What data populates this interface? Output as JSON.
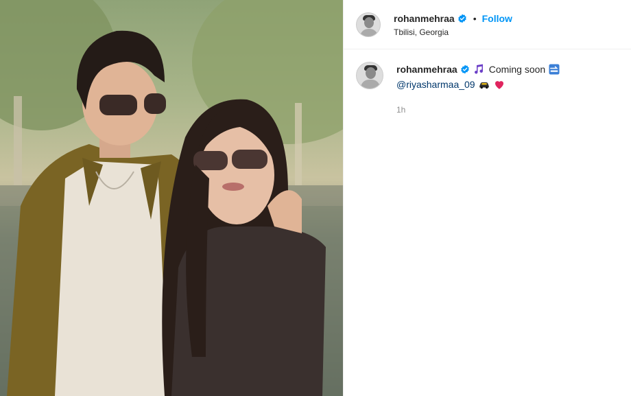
{
  "post": {
    "username": "rohanmehraa",
    "follow_label": "Follow",
    "separator": "•",
    "location": "Tbilisi, Georgia",
    "photo_alt": "Couple photo with sunglasses"
  },
  "caption": {
    "username": "rohanmehraa",
    "text": "Coming soon",
    "mention": "@riyasharmaa_09",
    "timestamp": "1h"
  },
  "icons": {
    "verified": "verified-badge-icon",
    "music": "music-notes-emoji",
    "soon": "soon-arrow-emoji",
    "car": "car-emoji",
    "heart": "red-heart-emoji"
  },
  "colors": {
    "link_blue": "#0095f6",
    "mention_blue": "#00376b",
    "verified_blue": "#0095f6",
    "muted": "#8e8e8e"
  }
}
